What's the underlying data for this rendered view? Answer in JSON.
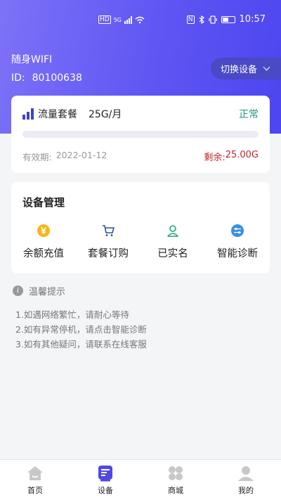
{
  "status_bar": {
    "hd_badge": "HD",
    "network_tag": "5G",
    "time": "10:57"
  },
  "device": {
    "name": "随身WIFI",
    "id_label": "ID:",
    "id_value": "80100638",
    "switch_label": "切换设备"
  },
  "plan": {
    "label": "流量套餐",
    "size": "25G/月",
    "status": "正常",
    "usage_fraction": 0.0,
    "validity_label": "有效期:",
    "validity_date": "2022-01-12",
    "remaining_label": "剩余:",
    "remaining_value": "25.00G"
  },
  "management": {
    "title": "设备管理",
    "items": [
      {
        "label": "余额充值",
        "icon": "yen-coin-icon",
        "color": "#f5b718"
      },
      {
        "label": "套餐订购",
        "icon": "cart-icon",
        "color": "#2f4f9a"
      },
      {
        "label": "已实名",
        "icon": "person-icon",
        "color": "#1aa57a"
      },
      {
        "label": "智能诊断",
        "icon": "diagnose-icon",
        "color": "#3a8ee6"
      }
    ]
  },
  "tips": {
    "title": "温馨提示",
    "lines": [
      "1.如遇网络繁忙，请耐心等待",
      "2.如有异常停机，请点击智能诊断",
      "3.如有其他疑问，请联系在线客服"
    ]
  },
  "tabbar": {
    "tabs": [
      {
        "label": "首页",
        "icon": "home-icon"
      },
      {
        "label": "设备",
        "icon": "device-icon",
        "active": true
      },
      {
        "label": "商城",
        "icon": "shop-icon"
      },
      {
        "label": "我的",
        "icon": "profile-icon"
      }
    ]
  },
  "colors": {
    "brand": "#5f55f3",
    "status_ok": "#1a9a7a",
    "remaining": "#c0262b"
  }
}
